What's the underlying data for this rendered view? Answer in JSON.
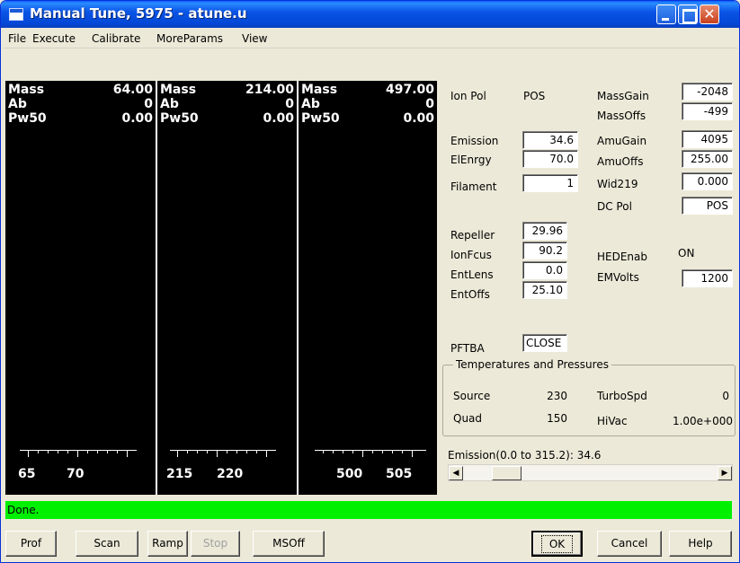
{
  "window": {
    "title": "Manual Tune, 5975 - atune.u"
  },
  "menu": [
    "File",
    "Execute",
    "Calibrate",
    "MoreParams",
    "View"
  ],
  "spectra": [
    {
      "mass": "64.00",
      "ab": "0",
      "pw50": "0.00",
      "ticks": [
        "65",
        "70"
      ]
    },
    {
      "mass": "214.00",
      "ab": "0",
      "pw50": "0.00",
      "ticks": [
        "215",
        "220"
      ]
    },
    {
      "mass": "497.00",
      "ab": "0",
      "pw50": "0.00",
      "ticks": [
        "500",
        "505"
      ]
    }
  ],
  "labels": {
    "mass": "Mass",
    "ab": "Ab",
    "pw50": "Pw50"
  },
  "params": {
    "ion_pol_label": "Ion Pol",
    "ion_pol_value": "POS",
    "emission_label": "Emission",
    "emission": "34.6",
    "elenergy_label": "ElEnrgy",
    "elenergy": "70.0",
    "filament_label": "Filament",
    "filament": "1",
    "repeller_label": "Repeller",
    "repeller": "29.96",
    "ionfocus_label": "IonFcus",
    "ionfocus": "90.2",
    "entlens_label": "EntLens",
    "entlens": "0.0",
    "entoffs_label": "EntOffs",
    "entoffs": "25.10",
    "pftba_label": "PFTBA",
    "pftba": "CLOSE",
    "massgain_label": "MassGain",
    "massgain": "-2048",
    "massoffs_label": "MassOffs",
    "massoffs": "-499",
    "amugain_label": "AmuGain",
    "amugain": "4095",
    "amuoffs_label": "AmuOffs",
    "amuoffs": "255.00",
    "wid219_label": "Wid219",
    "wid219": "0.000",
    "dcpol_label": "DC Pol",
    "dcpol": "POS",
    "hedenab_label": "HEDEnab",
    "hedenab": "ON",
    "emvolts_label": "EMVolts",
    "emvolts": "1200"
  },
  "temps": {
    "title": "Temperatures and Pressures",
    "source_label": "Source",
    "source": "230",
    "quad_label": "Quad",
    "quad": "150",
    "turbospd_label": "TurboSpd",
    "turbospd": "0",
    "hivac_label": "HiVac",
    "hivac": "1.00e+000"
  },
  "scroll": {
    "label": "Emission(0.0 to  315.2): 34.6",
    "level": 0.11
  },
  "status": "Done.",
  "buttons": {
    "prof": "Prof",
    "scan": "Scan",
    "ramp": "Ramp",
    "stop": "Stop",
    "msoff": "MSOff",
    "ok": "OK",
    "cancel": "Cancel",
    "help": "Help"
  }
}
